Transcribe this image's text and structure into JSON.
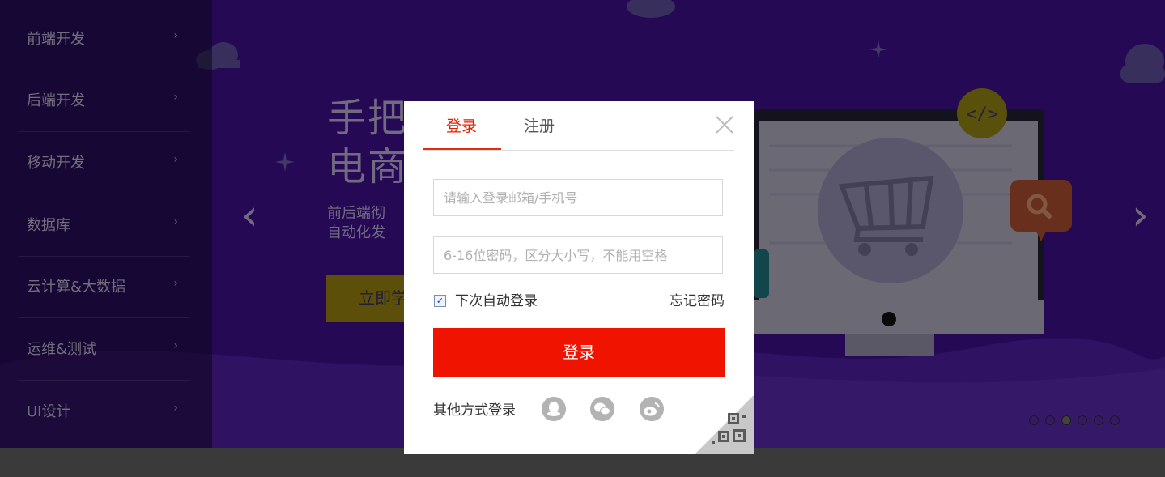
{
  "sidebar": {
    "items": [
      {
        "label": "前端开发"
      },
      {
        "label": "后端开发"
      },
      {
        "label": "移动开发"
      },
      {
        "label": "数据库"
      },
      {
        "label": "云计算&大数据"
      },
      {
        "label": "运维&测试"
      },
      {
        "label": "UI设计"
      }
    ],
    "chevron": "›"
  },
  "banner": {
    "headline_line1": "手把",
    "headline_line2": "电商",
    "sub_line1": "前后端彻",
    "sub_line2": "自动化发",
    "cta_partial": "立即学",
    "prev_arrow": "‹",
    "next_arrow": "›",
    "icons": [
      "code-bubble-icon",
      "shopping-cart-icon",
      "search-bubble-icon"
    ],
    "carousel_dots": 6,
    "carousel_active_dot": 3,
    "bg_color": "#2f0f66"
  },
  "modal": {
    "tab_login": "登录",
    "tab_register": "注册",
    "username_placeholder": "请输入登录邮箱/手机号",
    "password_placeholder": "6-16位密码，区分大小写，不能用空格",
    "remember_label": "下次自动登录",
    "remember_checked": true,
    "forgot_label": "忘记密码",
    "login_button": "登录",
    "other_login_label": "其他方式登录",
    "social_icons": [
      "qq-icon",
      "wechat-icon",
      "weibo-icon"
    ],
    "accent_color": "#f01400"
  }
}
